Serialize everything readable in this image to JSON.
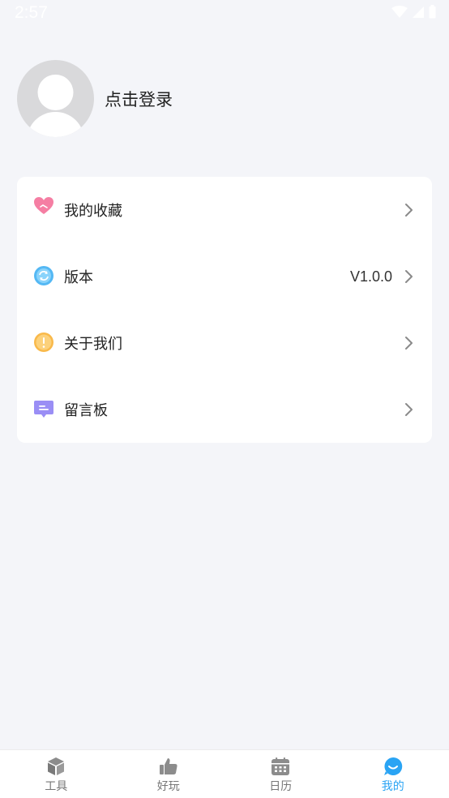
{
  "status_bar": {
    "time": "2:57",
    "icons": [
      "wifi-icon",
      "signal-icon",
      "battery-icon"
    ]
  },
  "profile": {
    "login_label": "点击登录",
    "avatar_icon": "default-avatar-icon"
  },
  "menu": {
    "items": [
      {
        "label": "我的收藏",
        "icon": "heart-icon",
        "value": ""
      },
      {
        "label": "版本",
        "icon": "refresh-icon",
        "value": "V1.0.0"
      },
      {
        "label": "关于我们",
        "icon": "info-icon",
        "value": ""
      },
      {
        "label": "留言板",
        "icon": "message-board-icon",
        "value": ""
      }
    ]
  },
  "bottom_nav": {
    "items": [
      {
        "label": "工具",
        "icon": "box-icon",
        "active": false
      },
      {
        "label": "好玩",
        "icon": "thumbs-up-icon",
        "active": false
      },
      {
        "label": "日历",
        "icon": "calendar-icon",
        "active": false
      },
      {
        "label": "我的",
        "icon": "smile-bubble-icon",
        "active": true
      }
    ]
  },
  "colors": {
    "background": "#f4f5f9",
    "card": "#ffffff",
    "accent": "#2aa4f4",
    "nav_inactive": "#777777",
    "avatar_bg": "#d9d9db"
  }
}
